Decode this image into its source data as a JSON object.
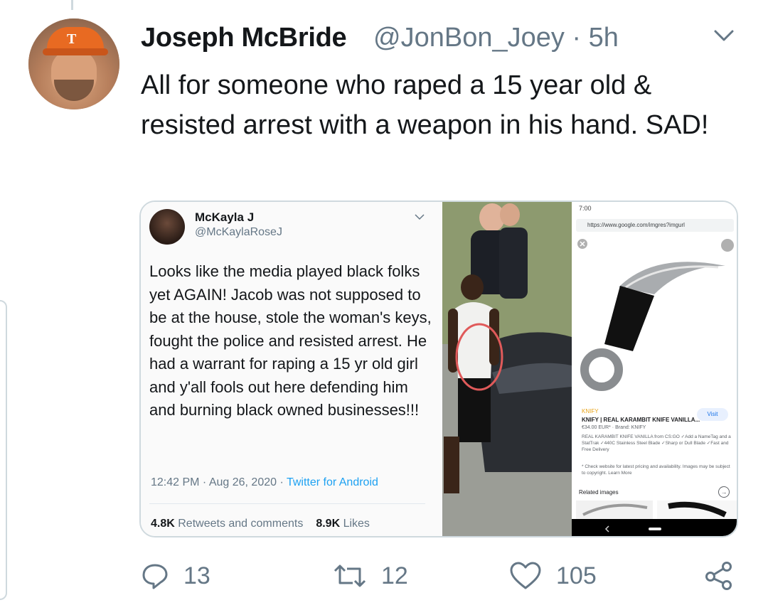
{
  "tweet": {
    "display_name": "Joseph McBride",
    "handle_time": "@JonBon_Joey · 5h",
    "text": "All for someone who raped a 15 year old & resisted arrest with a weapon in his hand. SAD!",
    "avatar_logo": "T"
  },
  "quoted_image": {
    "inner_tweet": {
      "display_name": "McKayla J",
      "handle": "@McKaylaRoseJ",
      "text": "Looks like the media played black folks yet AGAIN! Jacob was not supposed to be at the house, stole the woman's keys, fought the police and resisted arrest. He had a warrant for raping a 15 yr old girl and y'all fools out here defending him and burning black owned businesses!!!",
      "timestamp": "12:42 PM · Aug 26, 2020 · ",
      "app": "Twitter for Android",
      "retweets_count": "4.8K",
      "retweets_label": " Retweets and comments",
      "likes_count": "8.9K",
      "likes_label": " Likes"
    },
    "phone_screenshot": {
      "time": "7:00",
      "url": "https://www.google.com/imgres?imgurl",
      "brand": "KNIFY",
      "product_title": "KNIFY | REAL KARAMBIT KNIFE VANILLA...",
      "price": "€34.00 EUR* · Brand: KNIFY",
      "description": "REAL KARAMBIT KNIFE VANILLA from CS:GO ✓Add a NameTag and a StatTrak ✓440C Stainless Steel Blade ✓Sharp or Dull Blade ✓Fast and Free Delivery",
      "disclaimer": "* Check website for latest pricing and availability. Images may be subject to copyright. Learn More",
      "visit_label": "Visit",
      "related_label": "Related images"
    }
  },
  "actions": {
    "replies": "13",
    "retweets": "12",
    "likes": "105"
  },
  "colors": {
    "text": "#14171a",
    "secondary": "#657786",
    "link": "#1da1f2",
    "border": "#cfd9de"
  },
  "icons": [
    "chevron-down-icon",
    "reply-icon",
    "retweet-icon",
    "like-icon",
    "share-icon"
  ]
}
